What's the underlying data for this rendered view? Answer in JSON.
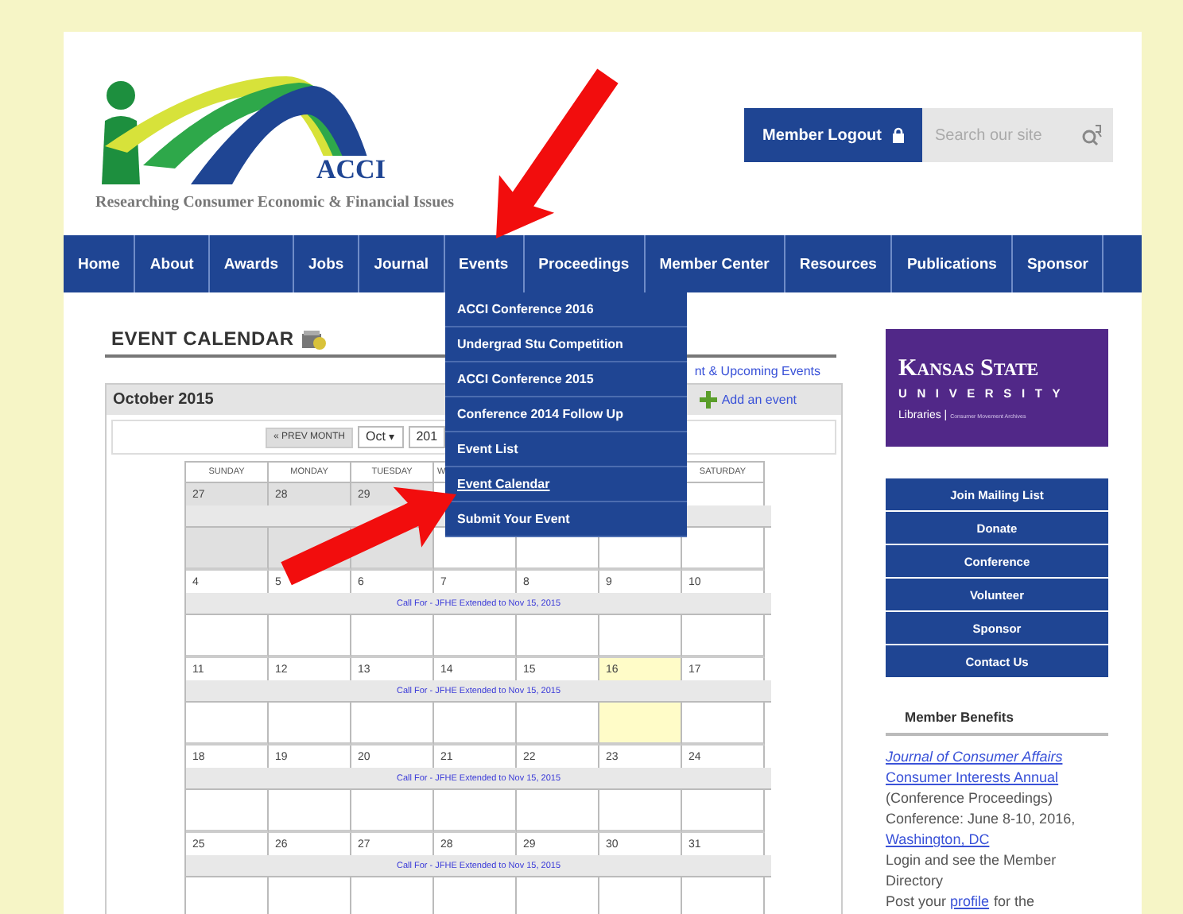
{
  "logo": {
    "text": "ACCI",
    "tagline": "Researching Consumer Economic & Financial Issues"
  },
  "header": {
    "logout_button": "Member Logout",
    "search": {
      "placeholder": "Search our site"
    }
  },
  "nav": [
    "Home",
    "About",
    "Awards",
    "Jobs",
    "Journal",
    "Events",
    "Proceedings",
    "Member Center",
    "Resources",
    "Publications",
    "Sponsor"
  ],
  "events_menu": [
    {
      "label": "ACCI Conference 2016",
      "selected": false
    },
    {
      "label": "Undergrad Stu Competition",
      "selected": false
    },
    {
      "label": "ACCI Conference 2015",
      "selected": false
    },
    {
      "label": "Conference 2014 Follow Up",
      "selected": false
    },
    {
      "label": "Event List",
      "selected": false
    },
    {
      "label": "Event Calendar",
      "selected": true
    },
    {
      "label": "Submit Your Event",
      "selected": false
    }
  ],
  "calendar": {
    "heading": "EVENT CALENDAR",
    "upcoming_link": "nt & Upcoming Events",
    "month_title": "October 2015",
    "add_event": "Add an event",
    "prev_month": "« PREV MONTH",
    "month_select": "Oct",
    "month_select_caret": "▾",
    "year_select": "201",
    "weekdays_left": [
      "SUNDAY",
      "MONDAY",
      "TUESDAY",
      "W"
    ],
    "weekdays_right": [
      "SATURDAY"
    ],
    "weeks": [
      {
        "days": [
          {
            "n": "27",
            "muted": true,
            "today": false
          },
          {
            "n": "28",
            "muted": true,
            "today": false
          },
          {
            "n": "29",
            "muted": true,
            "today": false
          }
        ]
      },
      {
        "event": "Call For - JFHE Extended to Nov 15, 2015",
        "days": [
          {
            "n": "4",
            "muted": false,
            "today": false
          },
          {
            "n": "5",
            "muted": false,
            "today": false
          },
          {
            "n": "6",
            "muted": false,
            "today": false
          },
          {
            "n": "7",
            "muted": false,
            "today": false
          },
          {
            "n": "8",
            "muted": false,
            "today": false
          },
          {
            "n": "9",
            "muted": false,
            "today": false
          },
          {
            "n": "10",
            "muted": false,
            "today": false
          }
        ]
      },
      {
        "event": "Call For - JFHE Extended to Nov 15, 2015",
        "days": [
          {
            "n": "11",
            "muted": false,
            "today": false
          },
          {
            "n": "12",
            "muted": false,
            "today": false
          },
          {
            "n": "13",
            "muted": false,
            "today": false
          },
          {
            "n": "14",
            "muted": false,
            "today": false
          },
          {
            "n": "15",
            "muted": false,
            "today": false
          },
          {
            "n": "16",
            "muted": false,
            "today": true
          },
          {
            "n": "17",
            "muted": false,
            "today": false
          }
        ]
      },
      {
        "event": "Call For - JFHE Extended to Nov 15, 2015",
        "days": [
          {
            "n": "18",
            "muted": false,
            "today": false
          },
          {
            "n": "19",
            "muted": false,
            "today": false
          },
          {
            "n": "20",
            "muted": false,
            "today": false
          },
          {
            "n": "21",
            "muted": false,
            "today": false
          },
          {
            "n": "22",
            "muted": false,
            "today": false
          },
          {
            "n": "23",
            "muted": false,
            "today": false
          },
          {
            "n": "24",
            "muted": false,
            "today": false
          }
        ]
      },
      {
        "event": "Call For - JFHE Extended to Nov 15, 2015",
        "days": [
          {
            "n": "25",
            "muted": false,
            "today": false
          },
          {
            "n": "26",
            "muted": false,
            "today": false
          },
          {
            "n": "27",
            "muted": false,
            "today": false
          },
          {
            "n": "28",
            "muted": false,
            "today": false
          },
          {
            "n": "29",
            "muted": false,
            "today": false
          },
          {
            "n": "30",
            "muted": false,
            "today": false
          },
          {
            "n": "31",
            "muted": false,
            "today": false
          }
        ]
      }
    ]
  },
  "sidebar": {
    "ksu_logo": {
      "name": "Kansas State",
      "university": "UNIVERSITY",
      "libraries": "Libraries |",
      "archive": "Consumer Movement Archives"
    },
    "buttons": [
      "Join Mailing List",
      "Donate",
      "Conference",
      "Volunteer",
      "Sponsor",
      "Contact Us"
    ],
    "benefits_title": "Member Benefits",
    "benefits": [
      {
        "kind": "link",
        "text": "Journal of Consumer Affairs",
        "italic": true
      },
      {
        "kind": "link",
        "text": "Consumer Interests Annual",
        "italic": false
      },
      {
        "kind": "text",
        "text": "(Conference Proceedings)"
      },
      {
        "kind": "mixed",
        "before": "Conference: June 8-10, 2016,",
        "link": "Washington, DC"
      },
      {
        "kind": "text",
        "text": "Login and see the Member Directory"
      },
      {
        "kind": "mixed",
        "before": "Post your",
        "link": "profile",
        "after": "for the"
      }
    ]
  }
}
